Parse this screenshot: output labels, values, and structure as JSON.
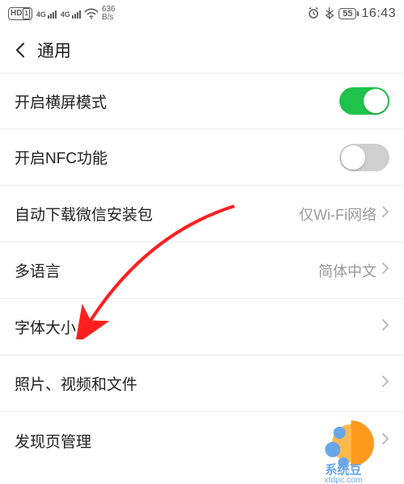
{
  "status": {
    "hd_label": "HD",
    "hd_sim": "1",
    "fourg": "4G",
    "net_speed_top": "636",
    "net_speed_bottom": "B/s",
    "battery_pct": "55",
    "time": "16:43"
  },
  "header": {
    "title": "通用"
  },
  "rows": {
    "landscape": {
      "label": "开启横屏模式",
      "on": true
    },
    "nfc": {
      "label": "开启NFC功能",
      "on": false
    },
    "download": {
      "label": "自动下载微信安装包",
      "value": "仅Wi-Fi网络"
    },
    "language": {
      "label": "多语言",
      "value": "简体中文"
    },
    "fontsize": {
      "label": "字体大小"
    },
    "media": {
      "label": "照片、视频和文件"
    },
    "discover": {
      "label": "发现页管理"
    }
  },
  "watermark": {
    "brand": "系统豆",
    "url": "xtdpc.com"
  }
}
